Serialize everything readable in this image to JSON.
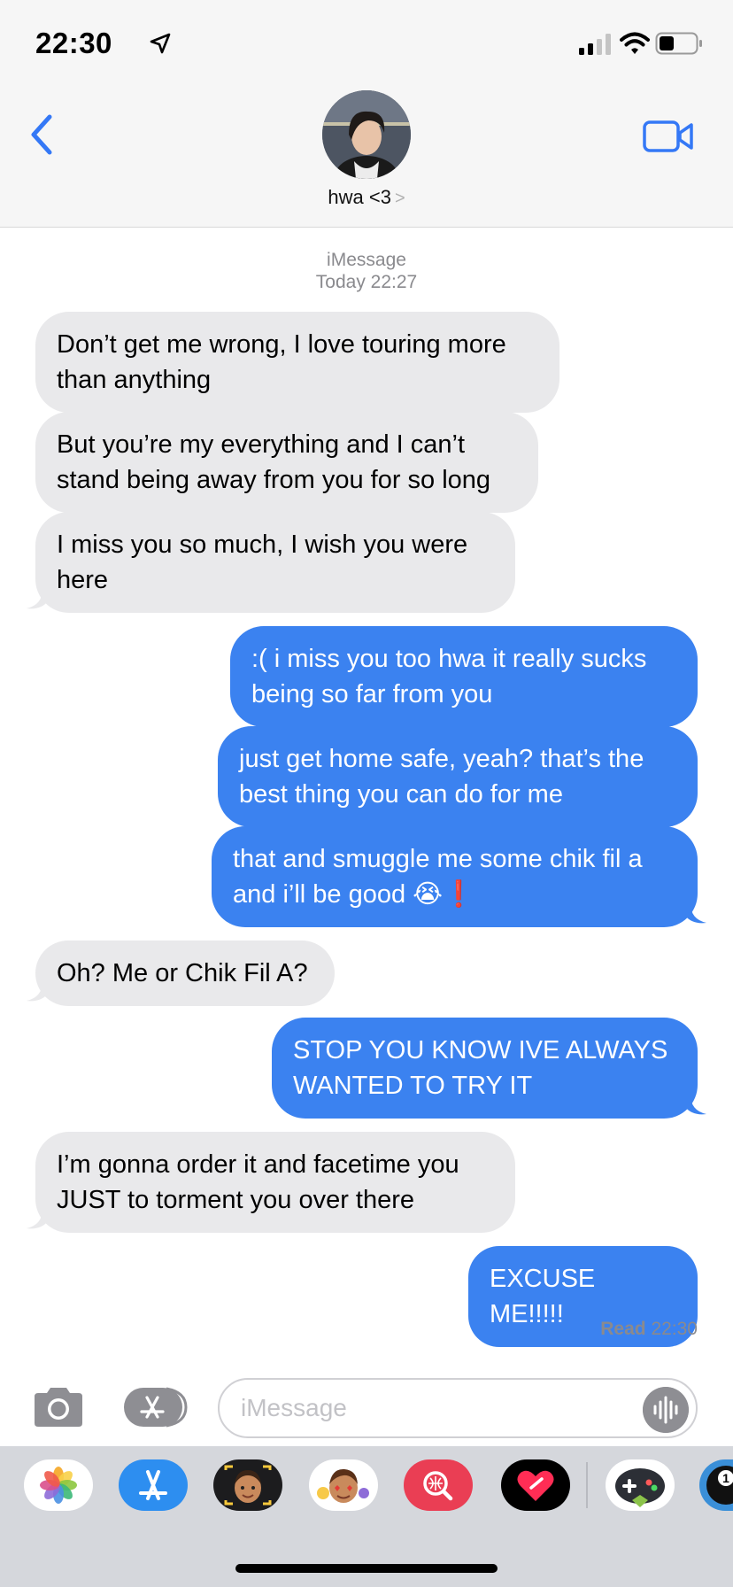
{
  "status_bar": {
    "time": "22:30"
  },
  "header": {
    "contact_name": "hwa <3",
    "chevron": ">"
  },
  "conversation": {
    "service": "iMessage",
    "timestamp": "Today 22:27",
    "messages": [
      {
        "from": "them",
        "line1": "Don’t get me wrong, I love touring more",
        "line2": "than anything"
      },
      {
        "from": "them",
        "line1": "But you’re my everything and I can’t",
        "line2": "stand being away from you for so long"
      },
      {
        "from": "them",
        "line1": "I miss you so much, I wish you were",
        "line2": "here"
      },
      {
        "from": "me",
        "line1": ":( i miss you too hwa it really sucks",
        "line2": "being so far from you"
      },
      {
        "from": "me",
        "line1": "just get home safe, yeah? that’s the",
        "line2": "best thing you can do for me"
      },
      {
        "from": "me",
        "line1": "that and smuggle me some chik fil a",
        "line2": "and i’ll be good 😭❗"
      },
      {
        "from": "them",
        "line1": "Oh? Me or Chik Fil A?"
      },
      {
        "from": "me",
        "line1": "STOP YOU KNOW IVE ALWAYS",
        "line2": "WANTED TO TRY IT"
      },
      {
        "from": "them",
        "line1": "I’m gonna order it and facetime you",
        "line2": "JUST to torment you over there"
      },
      {
        "from": "me",
        "line1": "EXCUSE ME!!!!!"
      }
    ],
    "read_label": "Read",
    "read_time": "22:30"
  },
  "composer": {
    "placeholder": "iMessage"
  },
  "app_drawer": {
    "apps": [
      "photos-icon",
      "app-store-icon",
      "memoji-icon",
      "animoji-icon",
      "image-search-icon",
      "digital-touch-icon",
      "game-icon",
      "pool-game-icon"
    ],
    "badge": "1"
  },
  "colors": {
    "outgoing": "#3b82f0",
    "incoming": "#e9e9eb",
    "accent": "#3478f6",
    "meta": "#8a8a8e"
  }
}
